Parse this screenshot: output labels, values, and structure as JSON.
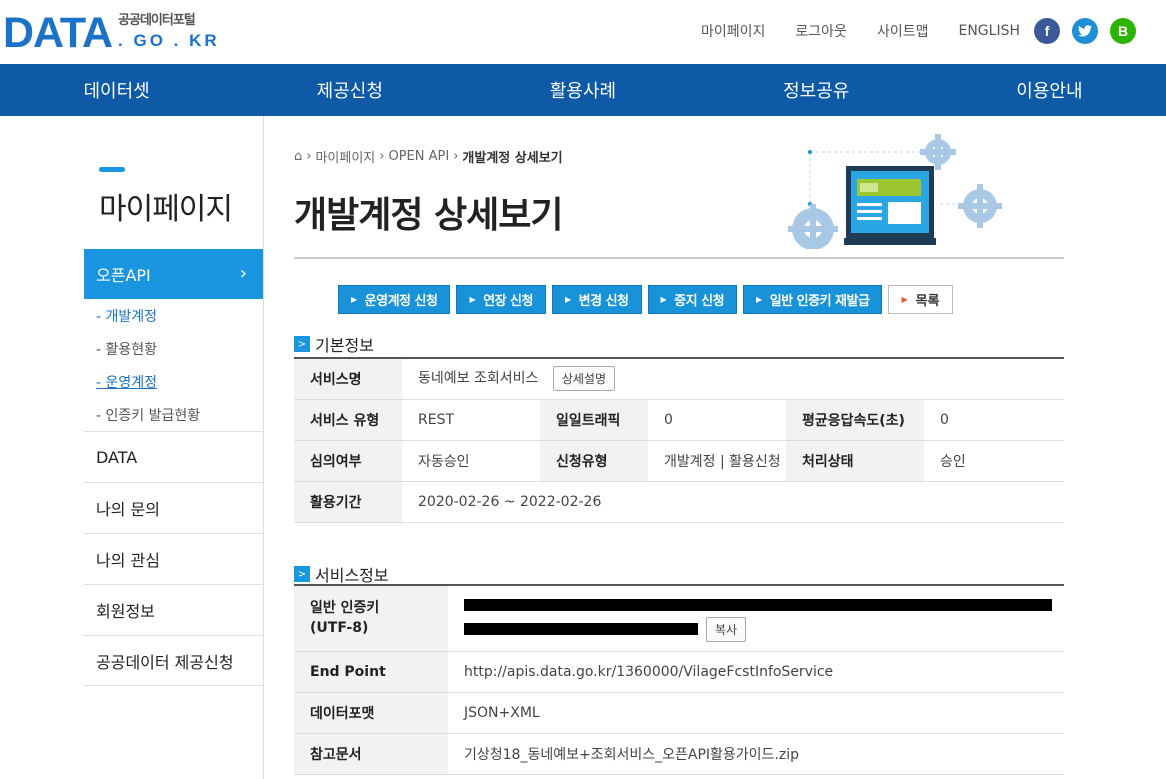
{
  "header": {
    "logo_main": "DATA",
    "logo_kr": "공공데이터포털",
    "logo_domain": ". GO . KR",
    "util_links": [
      "마이페이지",
      "로그아웃",
      "사이트맵",
      "ENGLISH"
    ],
    "sns": [
      {
        "name": "facebook-icon",
        "glyph": "f",
        "color": "#3b5998"
      },
      {
        "name": "twitter-icon",
        "glyph": "t",
        "color": "#1da1f2"
      },
      {
        "name": "blog-icon",
        "glyph": "B",
        "color": "#2db400"
      }
    ]
  },
  "gnb": [
    "데이터셋",
    "제공신청",
    "활용사례",
    "정보공유",
    "이용안내"
  ],
  "lnb": {
    "title": "마이페이지",
    "active": "오픈API",
    "subs": [
      "- 개발계정",
      "- 활용현황",
      "- 운영계정",
      "- 인증키 발급현황"
    ],
    "items": [
      "DATA",
      "나의 문의",
      "나의 관심",
      "회원정보",
      "공공데이터 제공신청"
    ]
  },
  "breadcrumb": {
    "home": "⌂",
    "items": [
      "마이페이지",
      "OPEN API"
    ],
    "current": "개발계정 상세보기"
  },
  "page_title": "개발계정 상세보기",
  "actions": [
    "운영계정 신청",
    "연장 신청",
    "변경 신청",
    "중지 신청",
    "일반 인증키 재발급"
  ],
  "list_button": "목록",
  "basic": {
    "heading": "기본정보",
    "service_name_label": "서비스명",
    "service_name": "동네예보 조회서비스",
    "detail_button": "상세설명",
    "type_label": "서비스 유형",
    "type": "REST",
    "traffic_label": "일일트래픽",
    "traffic": "0",
    "speed_label": "평균응답속도(초)",
    "speed": "0",
    "review_label": "심의여부",
    "review": "자동승인",
    "apply_type_label": "신청유형",
    "apply_type": "개발계정 | 활용신청",
    "status_label": "처리상태",
    "status": "승인",
    "period_label": "활용기간",
    "period": "2020-02-26 ~ 2022-02-26"
  },
  "service": {
    "heading": "서비스정보",
    "key_label_1": "일반 인증키",
    "key_label_2": "(UTF-8)",
    "copy_button": "복사",
    "endpoint_label": "End Point",
    "endpoint": "http://apis.data.go.kr/1360000/VilageFcstInfoService",
    "format_label": "데이터포맷",
    "format": "JSON+XML",
    "doc_label": "참고문서",
    "doc": "기상청18_동네예보+조회서비스_오픈API활용가이드.zip"
  }
}
